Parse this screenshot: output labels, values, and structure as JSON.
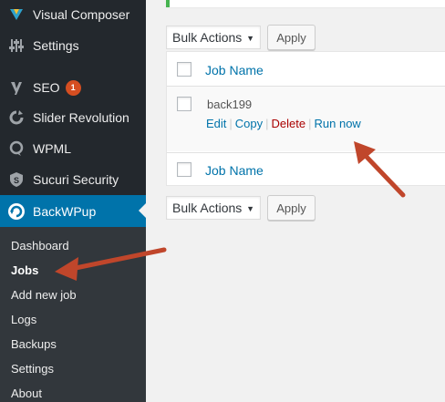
{
  "sidebar": {
    "items": [
      {
        "label": "Visual Composer"
      },
      {
        "label": "Settings"
      },
      {
        "label": "SEO",
        "badge": "1"
      },
      {
        "label": "Slider Revolution"
      },
      {
        "label": "WPML"
      },
      {
        "label": "Sucuri Security"
      },
      {
        "label": "BackWPup"
      }
    ],
    "submenu": [
      {
        "label": "Dashboard"
      },
      {
        "label": "Jobs"
      },
      {
        "label": "Add new job"
      },
      {
        "label": "Logs"
      },
      {
        "label": "Backups"
      },
      {
        "label": "Settings"
      },
      {
        "label": "About"
      }
    ]
  },
  "bulk_top": {
    "select_value": "Bulk Actions",
    "apply_label": "Apply"
  },
  "bulk_bottom": {
    "select_value": "Bulk Actions",
    "apply_label": "Apply"
  },
  "table": {
    "header_column": "Job Name",
    "footer_column": "Job Name",
    "rows": [
      {
        "job_name": "back199",
        "actions": {
          "edit": "Edit",
          "copy": "Copy",
          "delete": "Delete",
          "run": "Run now"
        }
      }
    ]
  },
  "colors": {
    "accent": "#0073aa",
    "annotation_arrow": "#c0462b",
    "sidebar_bg": "#23282d"
  }
}
